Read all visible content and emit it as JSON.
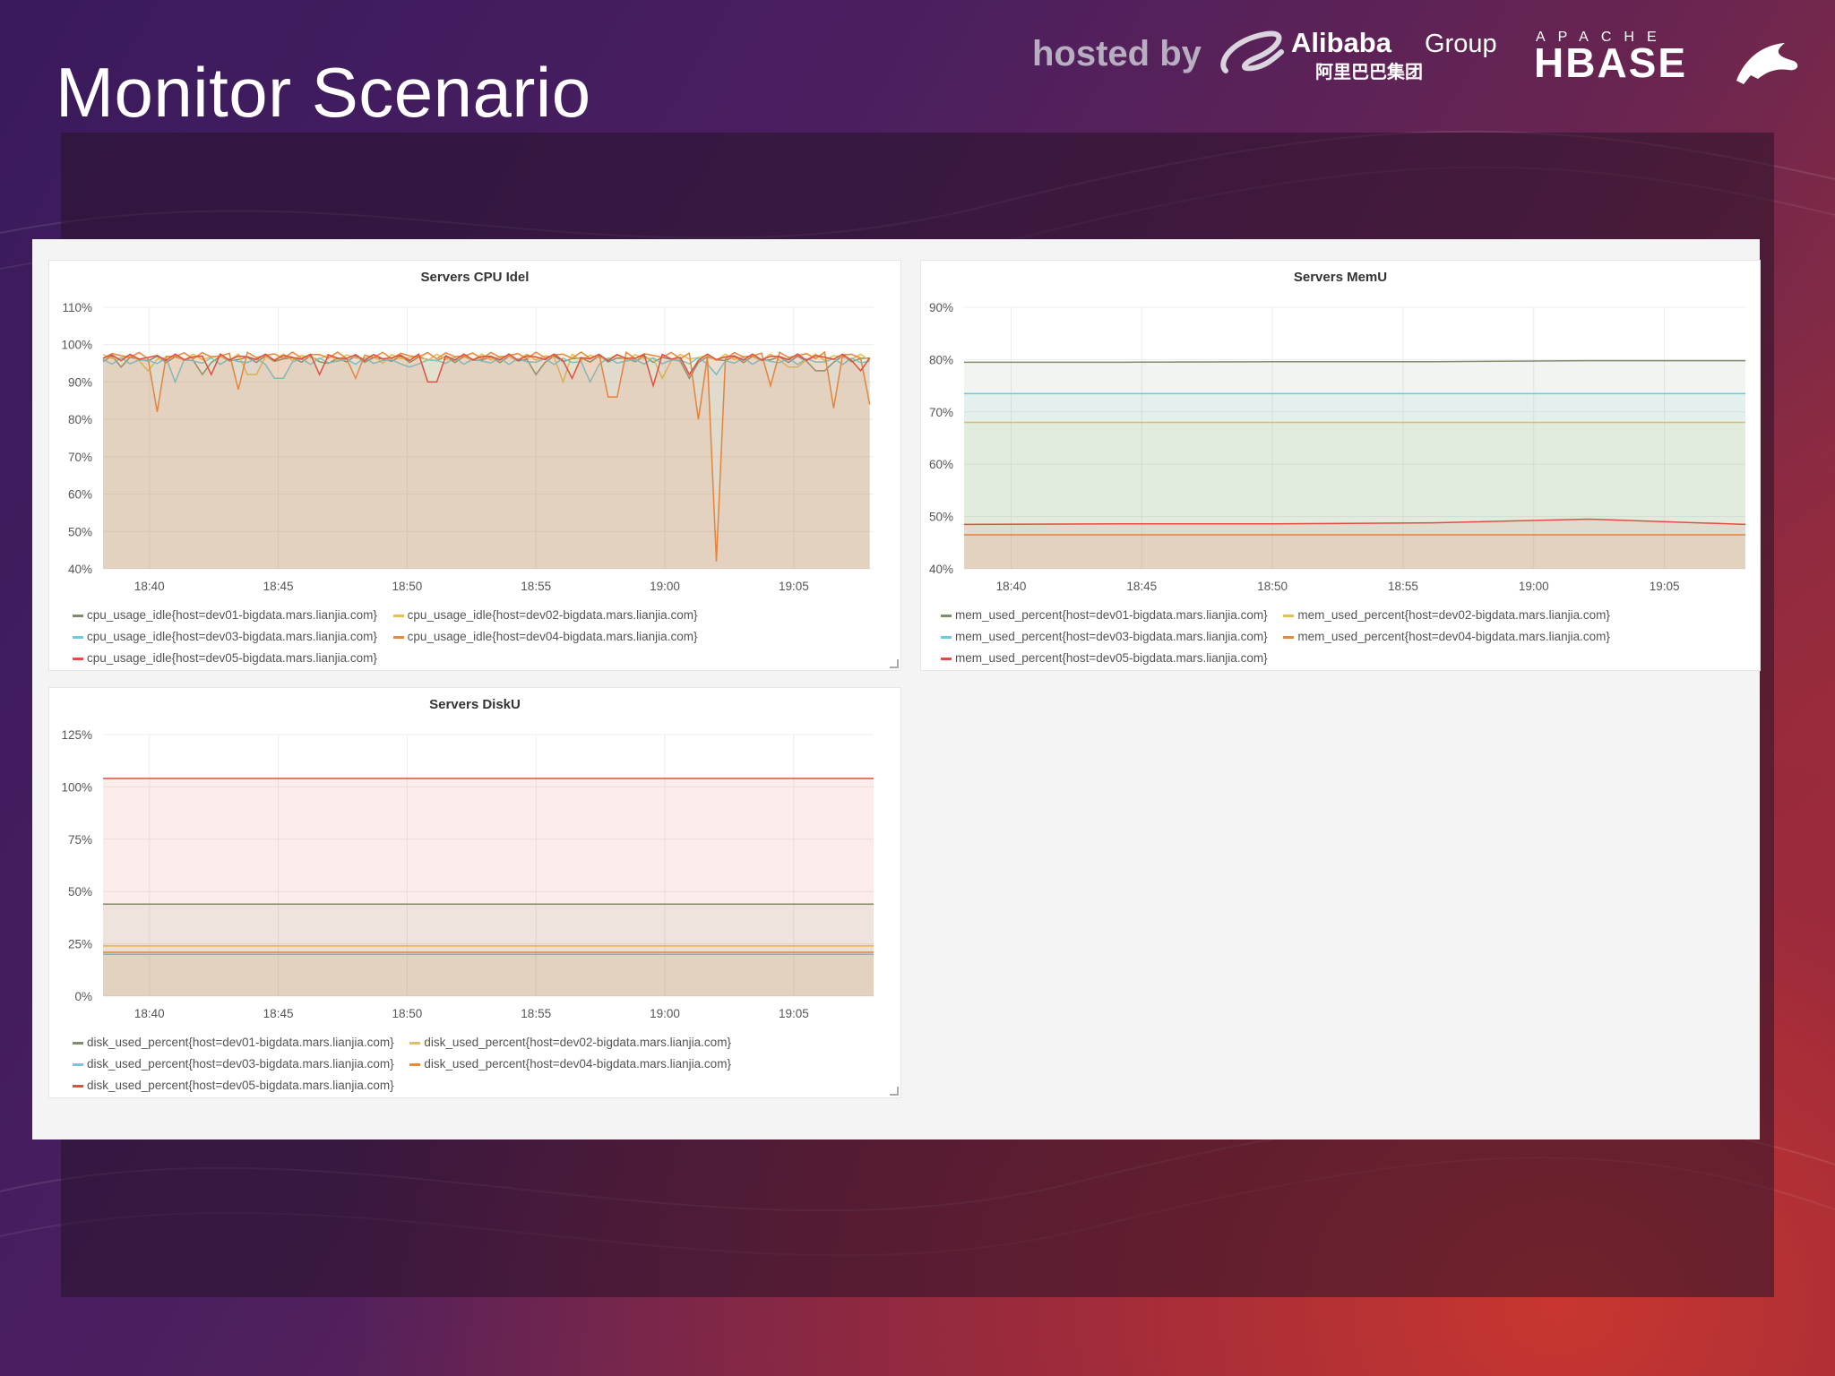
{
  "slide": {
    "title": "Monitor Scenario",
    "hosted_by": "hosted by",
    "alibaba": {
      "name": "Alibaba",
      "group": "Group",
      "chinese": "阿里巴巴集团"
    },
    "hbase": {
      "apache": "APACHE",
      "name": "HBASE",
      "icon": "orca-icon"
    }
  },
  "colors": {
    "dev01": "#7a8f6a",
    "dev02": "#e5c04a",
    "dev03": "#6ecad6",
    "dev04": "#e8893a",
    "dev05": "#e24d42"
  },
  "panels": [
    {
      "title": "Servers CPU Idel",
      "legend": [
        "cpu_usage_idle{host=dev01-bigdata.mars.lianjia.com}",
        "cpu_usage_idle{host=dev02-bigdata.mars.lianjia.com}",
        "cpu_usage_idle{host=dev03-bigdata.mars.lianjia.com}",
        "cpu_usage_idle{host=dev04-bigdata.mars.lianjia.com}",
        "cpu_usage_idle{host=dev05-bigdata.mars.lianjia.com}"
      ]
    },
    {
      "title": "Servers MemU",
      "legend": [
        "mem_used_percent{host=dev01-bigdata.mars.lianjia.com}",
        "mem_used_percent{host=dev02-bigdata.mars.lianjia.com}",
        "mem_used_percent{host=dev03-bigdata.mars.lianjia.com}",
        "mem_used_percent{host=dev04-bigdata.mars.lianjia.com}",
        "mem_used_percent{host=dev05-bigdata.mars.lianjia.com}"
      ]
    },
    {
      "title": "Servers DiskU",
      "legend": [
        "disk_used_percent{host=dev01-bigdata.mars.lianjia.com}",
        "disk_used_percent{host=dev02-bigdata.mars.lianjia.com}",
        "disk_used_percent{host=dev03-bigdata.mars.lianjia.com}",
        "disk_used_percent{host=dev04-bigdata.mars.lianjia.com}",
        "disk_used_percent{host=dev05-bigdata.mars.lianjia.com}"
      ]
    }
  ],
  "chart_data": [
    {
      "type": "area",
      "title": "Servers CPU Idel",
      "x": [
        "18:40",
        "18:45",
        "18:50",
        "18:55",
        "19:00",
        "19:05"
      ],
      "yticks": [
        "40%",
        "50%",
        "60%",
        "70%",
        "80%",
        "90%",
        "100%",
        "110%"
      ],
      "ylim": [
        40,
        110
      ],
      "xlim_minutes": [
        38.2,
        68.1
      ],
      "series": [
        {
          "name": "cpu_usage_idle{host=dev01-bigdata.mars.lianjia.com}",
          "base": 97,
          "dips": [
            [
              39,
              94
            ],
            [
              42,
              92
            ],
            [
              47,
              95
            ],
            [
              55,
              92
            ],
            [
              61,
              91
            ],
            [
              66,
              93
            ]
          ]
        },
        {
          "name": "cpu_usage_idle{host=dev02-bigdata.mars.lianjia.com}",
          "base": 97.5,
          "dips": [
            [
              40,
              93
            ],
            [
              44,
              92
            ],
            [
              49,
              95
            ],
            [
              56,
              90
            ],
            [
              60,
              91
            ],
            [
              65,
              94
            ]
          ]
        },
        {
          "name": "cpu_usage_idle{host=dev03-bigdata.mars.lianjia.com}",
          "base": 96.5,
          "dips": [
            [
              41,
              90
            ],
            [
              45,
              91
            ],
            [
              50,
              94
            ],
            [
              57,
              90
            ],
            [
              62,
              92
            ]
          ]
        },
        {
          "name": "cpu_usage_idle{host=dev04-bigdata.mars.lianjia.com}",
          "base": 98,
          "dips": [
            [
              40.3,
              82
            ],
            [
              43.5,
              88
            ],
            [
              48,
              91
            ],
            [
              58,
              86
            ],
            [
              61.4,
              80
            ],
            [
              62.1,
              42
            ],
            [
              64,
              89
            ],
            [
              66.5,
              83
            ],
            [
              68,
              84
            ]
          ]
        },
        {
          "name": "cpu_usage_idle{host=dev05-bigdata.mars.lianjia.com}",
          "base": 97.5,
          "dips": [
            [
              42.5,
              92
            ],
            [
              46.5,
              92
            ],
            [
              51,
              90
            ],
            [
              56.5,
              91
            ],
            [
              59.5,
              89
            ],
            [
              61,
              92
            ],
            [
              67.5,
              93
            ]
          ]
        }
      ]
    },
    {
      "type": "area",
      "title": "Servers MemU",
      "x": [
        "18:40",
        "18:45",
        "18:50",
        "18:55",
        "19:00",
        "19:05"
      ],
      "yticks": [
        "40%",
        "50%",
        "60%",
        "70%",
        "80%",
        "90%"
      ],
      "ylim": [
        40,
        90
      ],
      "xlim_minutes": [
        38.2,
        68.1
      ],
      "series": [
        {
          "name": "mem_used_percent{host=dev01-bigdata.mars.lianjia.com}",
          "values": [
            79.5,
            79.5,
            79.6,
            79.6,
            79.8,
            79.8
          ]
        },
        {
          "name": "mem_used_percent{host=dev02-bigdata.mars.lianjia.com}",
          "values": [
            68,
            68,
            68,
            68,
            68,
            68
          ]
        },
        {
          "name": "mem_used_percent{host=dev03-bigdata.mars.lianjia.com}",
          "values": [
            73.5,
            73.5,
            73.5,
            73.5,
            73.5,
            73.5
          ]
        },
        {
          "name": "mem_used_percent{host=dev04-bigdata.mars.lianjia.com}",
          "values": [
            46.5,
            46.5,
            46.5,
            46.5,
            46.5,
            46.5
          ]
        },
        {
          "name": "mem_used_percent{host=dev05-bigdata.mars.lianjia.com}",
          "values": [
            48.5,
            48.6,
            48.6,
            48.8,
            49.5,
            48.5
          ]
        }
      ]
    },
    {
      "type": "area",
      "title": "Servers DiskU",
      "x": [
        "18:40",
        "18:45",
        "18:50",
        "18:55",
        "19:00",
        "19:05"
      ],
      "yticks": [
        "0%",
        "25%",
        "50%",
        "75%",
        "100%",
        "125%"
      ],
      "ylim": [
        0,
        125
      ],
      "xlim_minutes": [
        38.2,
        68.1
      ],
      "series": [
        {
          "name": "disk_used_percent{host=dev01-bigdata.mars.lianjia.com}",
          "values": [
            44,
            44,
            44,
            44,
            44,
            44
          ]
        },
        {
          "name": "disk_used_percent{host=dev02-bigdata.mars.lianjia.com}",
          "values": [
            24,
            24,
            24,
            24,
            24,
            24
          ]
        },
        {
          "name": "disk_used_percent{host=dev03-bigdata.mars.lianjia.com}",
          "values": [
            20,
            20,
            20,
            20,
            20,
            20
          ]
        },
        {
          "name": "disk_used_percent{host=dev04-bigdata.mars.lianjia.com}",
          "values": [
            21,
            21,
            21,
            21,
            21,
            21
          ]
        },
        {
          "name": "disk_used_percent{host=dev05-bigdata.mars.lianjia.com}",
          "values": [
            104,
            104,
            104,
            104,
            104,
            104
          ]
        }
      ]
    }
  ]
}
